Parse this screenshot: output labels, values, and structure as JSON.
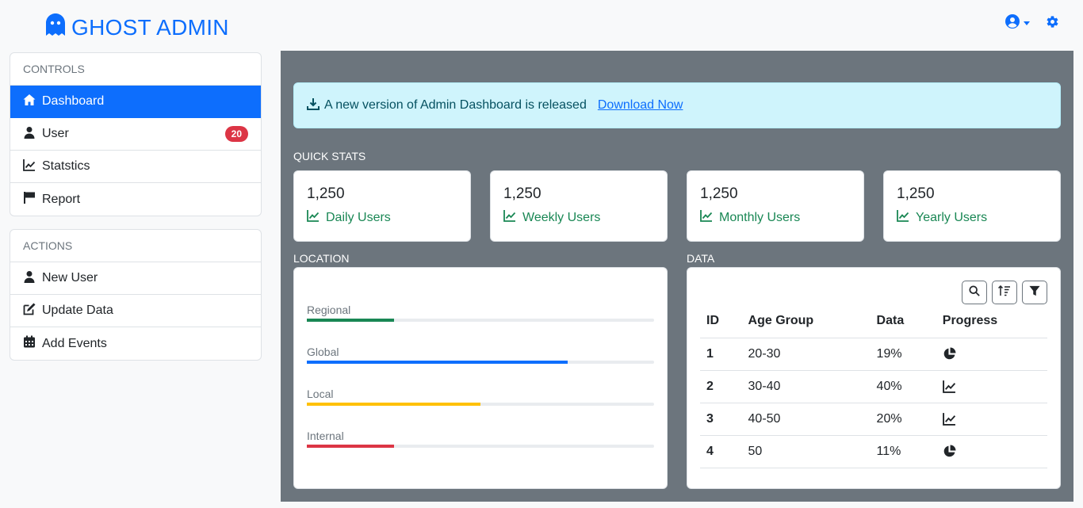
{
  "header": {
    "brand": "GHOST ADMIN",
    "icons": [
      "ghost-icon",
      "user-circle-icon",
      "gear-icon"
    ]
  },
  "sidebar": {
    "controls": {
      "title": "CONTROLS",
      "items": [
        {
          "label": "Dashboard",
          "icon": "home-icon",
          "active": true
        },
        {
          "label": "User",
          "icon": "user-icon",
          "badge": "20"
        },
        {
          "label": "Statstics",
          "icon": "chart-line-icon"
        },
        {
          "label": "Report",
          "icon": "flag-icon"
        }
      ]
    },
    "actions": {
      "title": "ACTIONS",
      "items": [
        {
          "label": "New User",
          "icon": "user-icon"
        },
        {
          "label": "Update Data",
          "icon": "edit-icon"
        },
        {
          "label": "Add Events",
          "icon": "calendar-icon"
        }
      ]
    }
  },
  "alert": {
    "message": "A new version of Admin Dashboard is released",
    "link": "Download Now",
    "icon": "download-icon"
  },
  "quick_stats": {
    "title": "QUICK STATS",
    "cards": [
      {
        "value": "1,250",
        "label": "Daily Users"
      },
      {
        "value": "1,250",
        "label": "Weekly Users"
      },
      {
        "value": "1,250",
        "label": "Monthly Users"
      },
      {
        "value": "1,250",
        "label": "Yearly Users"
      }
    ]
  },
  "location": {
    "title": "LOCATION",
    "items": [
      {
        "label": "Regional",
        "progress": 0.25,
        "color": "#198754"
      },
      {
        "label": "Global",
        "progress": 0.75,
        "color": "#0d6efd"
      },
      {
        "label": "Local",
        "progress": 0.5,
        "color": "#ffc107"
      },
      {
        "label": "Internal",
        "progress": 0.25,
        "color": "#dc3545"
      }
    ]
  },
  "data": {
    "title": "DATA",
    "toolbar": [
      "search-icon",
      "sort-icon",
      "filter-icon"
    ],
    "columns": [
      "ID",
      "Age Group",
      "Data",
      "Progress"
    ],
    "rows": [
      {
        "id": "1",
        "age_group": "20-30",
        "data": "19%",
        "icon": "pie-chart-icon"
      },
      {
        "id": "2",
        "age_group": "30-40",
        "data": "40%",
        "icon": "chart-line-icon"
      },
      {
        "id": "3",
        "age_group": "40-50",
        "data": "20%",
        "icon": "chart-line-icon"
      },
      {
        "id": "4",
        "age_group": "50",
        "data": "11%",
        "icon": "pie-chart-icon"
      }
    ]
  },
  "colors": {
    "primary": "#0d6efd",
    "success": "#198754",
    "danger": "#dc3545",
    "warning": "#ffc107",
    "main_bg": "#6c757d",
    "alert_bg": "#cff4fc"
  }
}
